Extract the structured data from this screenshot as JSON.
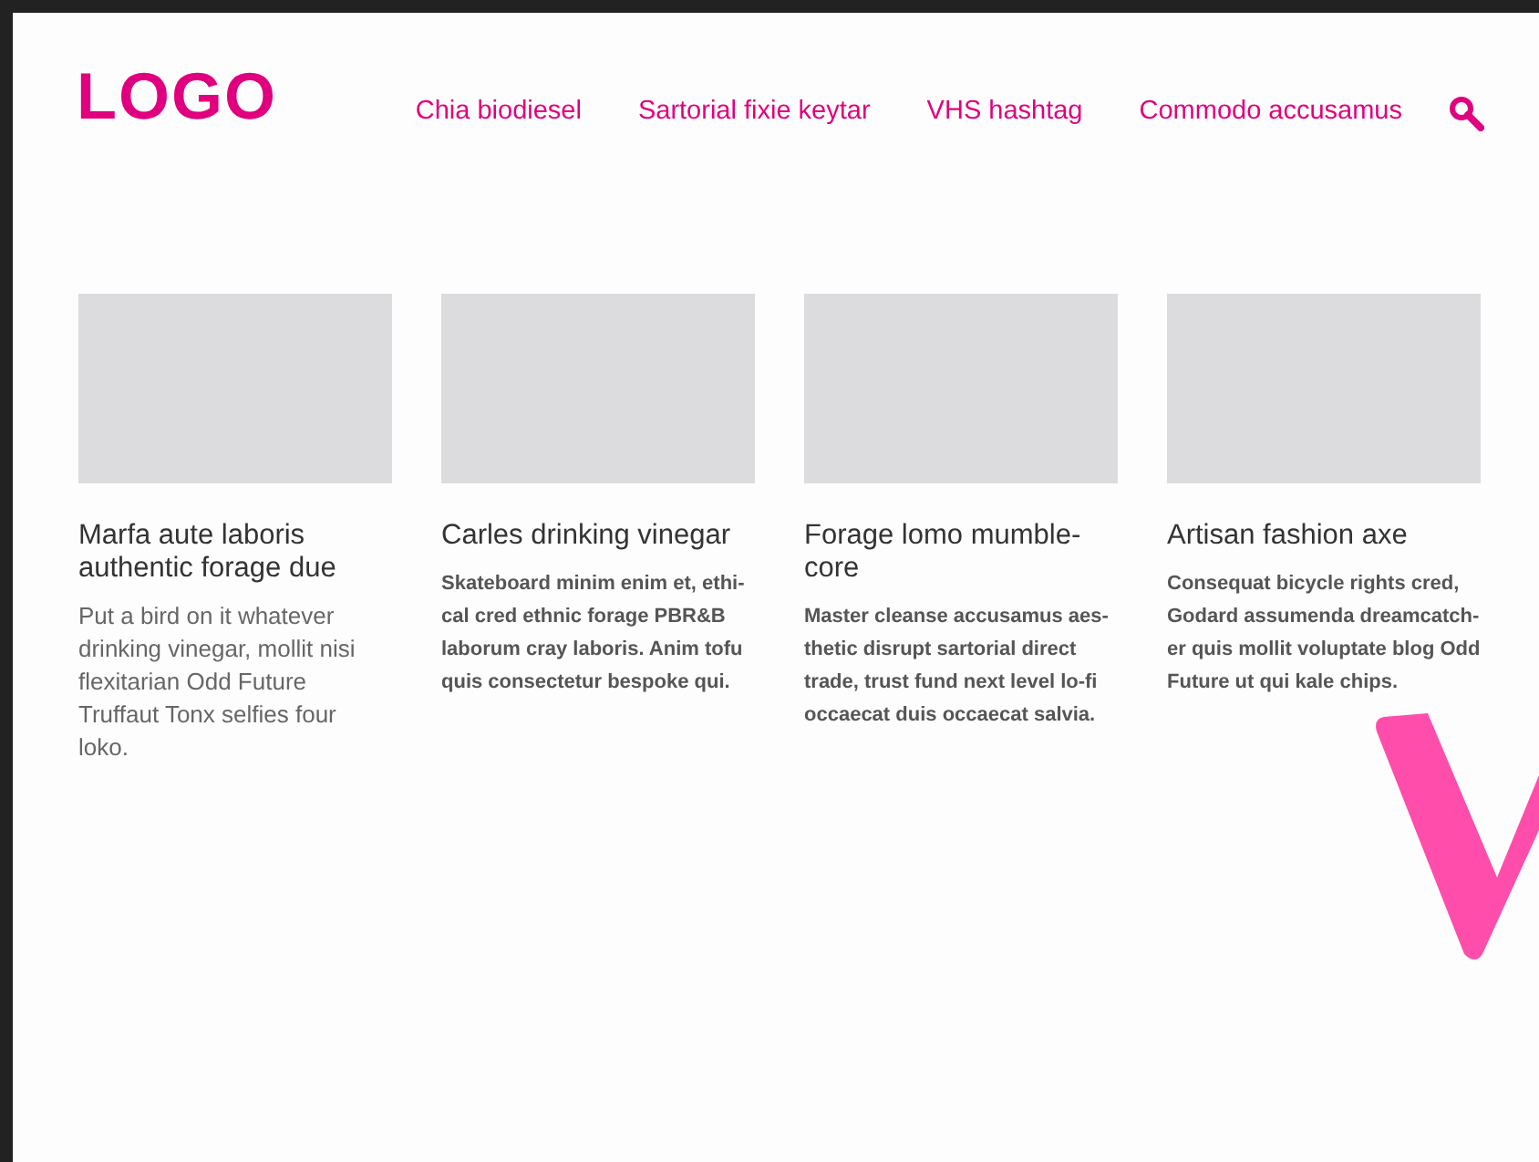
{
  "logo": "LOGO",
  "nav": [
    "Chia biodiesel",
    "Sartorial fixie keytar",
    "VHS hashtag",
    "Commodo accusamus"
  ],
  "cards": [
    {
      "title": "Marfa aute laboris authentic forage due",
      "kind": "large",
      "text": "Put a bird on it whatever drinking vinegar, mollit nisi flexitarian Odd Future Truffaut Tonx selfies four loko."
    },
    {
      "title": "Carles drinking vinegar",
      "kind": "small",
      "text": "Skateboard minim enim et, ethi-cal cred ethnic forage PBR&B laborum cray laboris. Anim tofu quis consectetur bespoke qui."
    },
    {
      "title": "Forage lomo mumble-core",
      "kind": "small",
      "text": "Master cleanse accusamus aes-thetic disrupt sartorial direct trade, trust fund next level lo-fi occaecat duis occaecat salvia."
    },
    {
      "title": "Artisan fashion axe",
      "kind": "small",
      "text": "Consequat bicycle rights cred, Godard assumenda dreamcatch-er quis mollit voluptate blog Odd Future ut qui kale chips."
    }
  ]
}
